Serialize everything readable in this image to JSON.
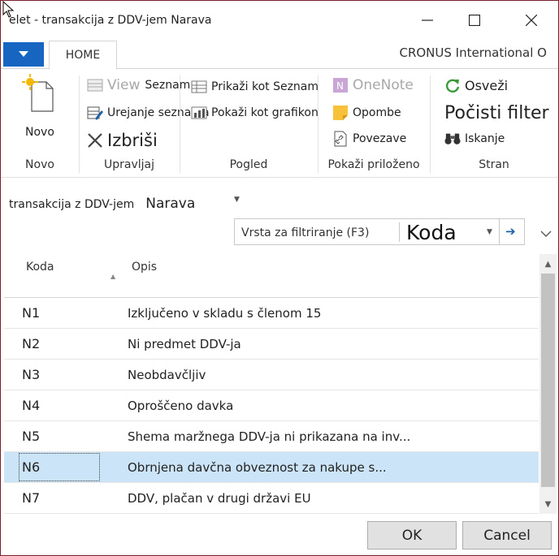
{
  "window": {
    "title": "Uredi - transakcija z DDV-jem  Narava",
    "title_visible": "elet - transakcija z DDV-jem  Narava"
  },
  "ribbon": {
    "tab_home": "HOME",
    "company": "CRONUS International O",
    "groups": {
      "novo": {
        "label": "Novo",
        "new_button": "Novo"
      },
      "upravljaj": {
        "label": "Upravljaj",
        "view": "View",
        "view_list": "Seznam",
        "edit_list": "Urejanje seznama",
        "delete": "Izbriši"
      },
      "pogled": {
        "label": "Pogled",
        "show_as_list": "Prikaži kot  Seznam",
        "show_as_chart": "Pokaži kot grafikon"
      },
      "prilozeno": {
        "label": "Pokaži priloženo",
        "onenote": "OneNote",
        "notes": "Opombe",
        "links": "Povezave"
      },
      "stran": {
        "label": "Stran",
        "refresh": "Osveži",
        "clear_filter": "Počisti filter",
        "search": "Iskanje"
      }
    }
  },
  "filter": {
    "caption_entity": "transakcija z DDV-jem",
    "caption_field": "Narava",
    "placeholder": "Vrsta za filtriranje (F3)",
    "field": "Koda"
  },
  "grid": {
    "columns": [
      "Koda",
      "Opis"
    ],
    "rows": [
      {
        "code": "N1",
        "desc": "Izključeno v skladu s členom 15"
      },
      {
        "code": "N2",
        "desc": "Ni predmet DDV-ja"
      },
      {
        "code": "N3",
        "desc": "Neobdavčljiv"
      },
      {
        "code": "N4",
        "desc": "Oproščeno davka"
      },
      {
        "code": "N5",
        "desc": "Shema maržnega DDV-ja ni prikazana na inv..."
      },
      {
        "code": "N6",
        "desc": "Obrnjena davčna obveznost za nakupe s..."
      },
      {
        "code": "N7",
        "desc": "DDV, plačan v drugi državi EU"
      }
    ],
    "selected_index": 5
  },
  "buttons": {
    "ok": "OK",
    "cancel": "Cancel"
  },
  "colors": {
    "accent": "#1665c0",
    "selection": "#cce4f7",
    "border": "#7a1f2e"
  }
}
